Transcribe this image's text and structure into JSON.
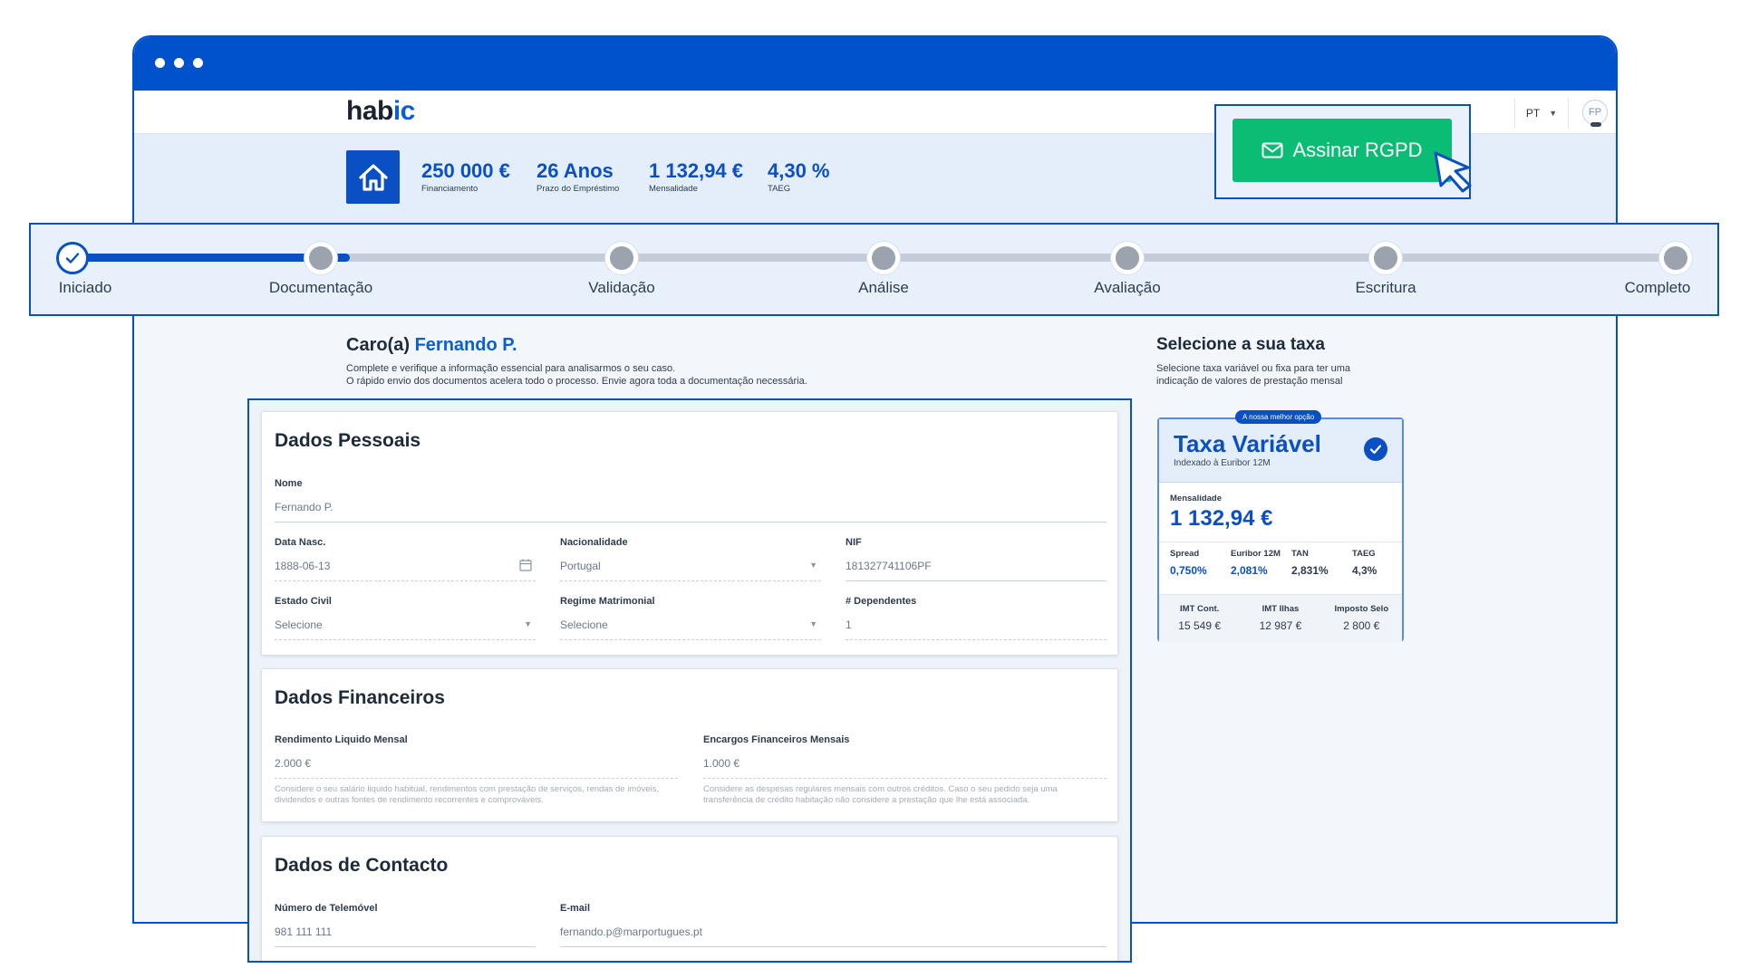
{
  "app": {
    "logo_main": "hab",
    "logo_accent": "ic",
    "language": "PT",
    "avatar_initials": "FP"
  },
  "summary": {
    "stats": [
      {
        "value": "250 000 €",
        "label": "Financiamento"
      },
      {
        "value": "26 Anos",
        "label": "Prazo do Empréstimo"
      },
      {
        "value": "1 132,94 €",
        "label": "Mensalidade"
      },
      {
        "value": "4,30 %",
        "label": "TAEG"
      }
    ]
  },
  "rgpd": {
    "label": "Assinar RGPD",
    "color": "#0bbd74"
  },
  "stepper": {
    "steps": [
      "Iniciado",
      "Documentação",
      "Validação",
      "Análise",
      "Avaliação",
      "Escritura",
      "Completo"
    ],
    "completed": 1,
    "accent": "#0a4fc4"
  },
  "greeting": {
    "prefix": "Caro(a) ",
    "name": "Fernando P.",
    "line1": "Complete e verifique a informação essencial para analisarmos o seu caso.",
    "line2": "O rápido envio dos documentos acelera todo o processo. Envie agora toda a documentação necessária."
  },
  "rate_panel": {
    "title": "Selecione a sua taxa",
    "subtitle": "Selecione taxa variável ou fixa para ter uma indicação de valores de prestação mensal",
    "card": {
      "badge": "A nossa melhor opção",
      "title": "Taxa Variável",
      "subtitle": "Indexado à Euribor 12M",
      "mens_label": "Mensalidade",
      "mens_value": "1 132,94 €",
      "metrics": [
        {
          "label": "Spread",
          "value": "0,750%"
        },
        {
          "label": "Euribor 12M",
          "value": "2,081%"
        },
        {
          "label": "TAN",
          "value": "2,831%"
        },
        {
          "label": "TAEG",
          "value": "4,3%"
        }
      ],
      "taxes": [
        {
          "label": "IMT Cont.",
          "value": "15 549 €"
        },
        {
          "label": "IMT Ilhas",
          "value": "12 987 €"
        },
        {
          "label": "Imposto Selo",
          "value": "2 800 €"
        }
      ]
    }
  },
  "form": {
    "personal": {
      "title": "Dados Pessoais",
      "nome_label": "Nome",
      "nome_value": "Fernando P.",
      "nasc_label": "Data Nasc.",
      "nasc_value": "1888-06-13",
      "nac_label": "Nacionalidade",
      "nac_value": "Portugal",
      "nif_label": "NIF",
      "nif_value": "181327741106PF",
      "civil_label": "Estado Civil",
      "civil_value": "Selecione",
      "regime_label": "Regime Matrimonial",
      "regime_value": "Selecione",
      "dep_label": "# Dependentes",
      "dep_value": "1"
    },
    "financial": {
      "title": "Dados Financeiros",
      "income_label": "Rendimento Liquido Mensal",
      "income_value": "2.000 €",
      "income_hint": "Considere o seu salário liquido habitual, rendimentos com prestação de serviços, rendas de imóveis, dividendos e outras fontes de rendimento recorrentes e comprováveis.",
      "charges_label": "Encargos Financeiros Mensais",
      "charges_value": "1.000 €",
      "charges_hint": "Considere as despesas regulares mensais com outros créditos. Caso o seu pedido seja uma transferência de crédito habitação não considere a prestação que lhe está associada."
    },
    "contact": {
      "title": "Dados de Contacto",
      "phone_label": "Número de Telemóvel",
      "phone_value": "981 111 111",
      "email_label": "E-mail",
      "email_value": "fernando.p@marportugues.pt"
    }
  }
}
